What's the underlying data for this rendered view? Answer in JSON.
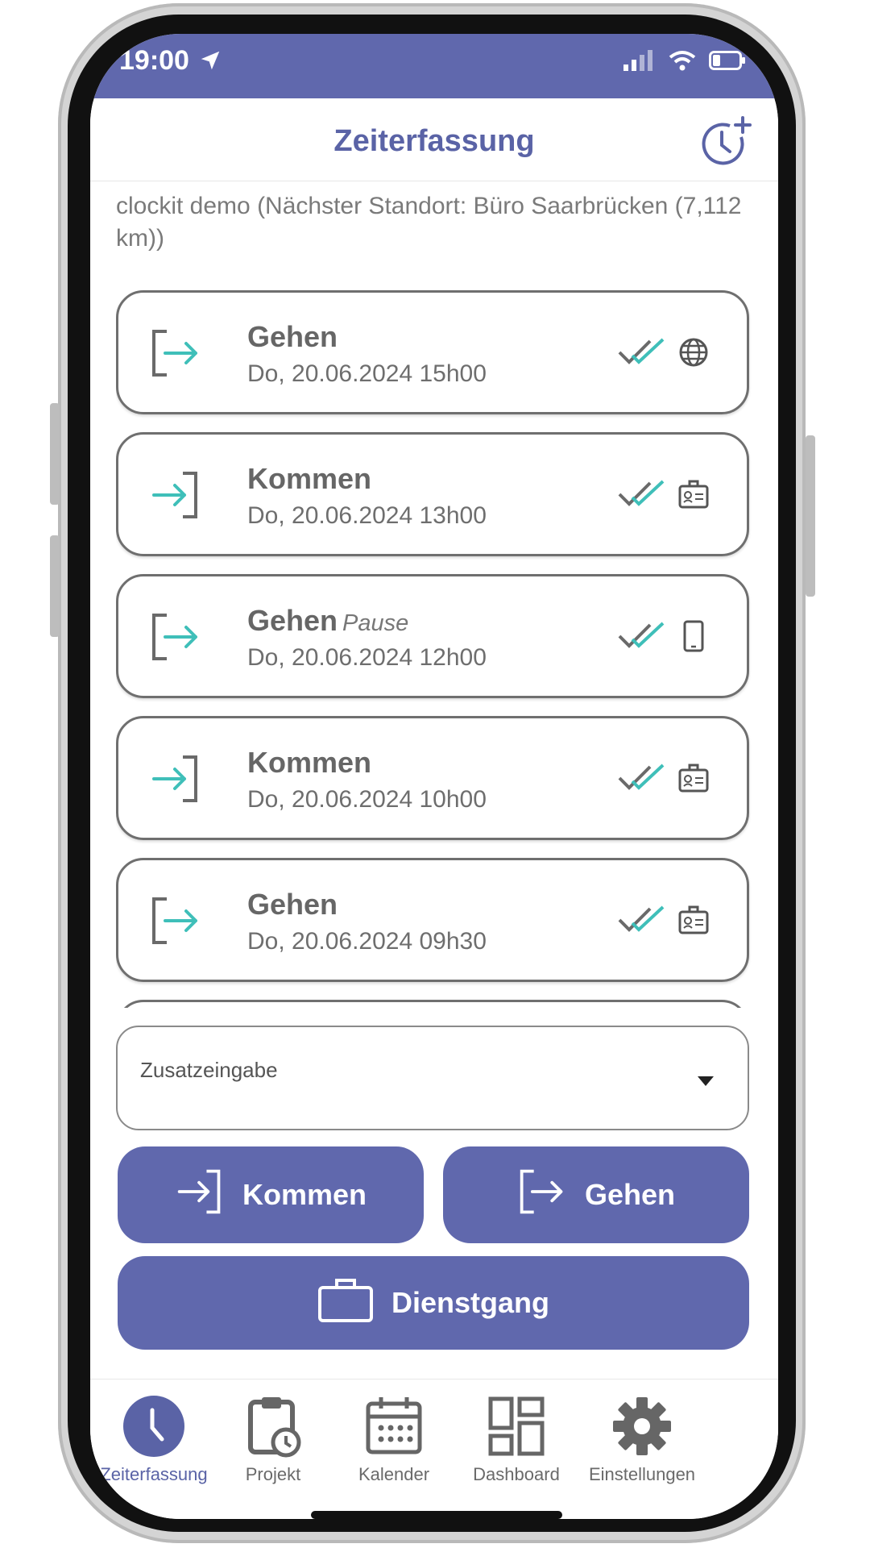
{
  "status_bar": {
    "time": "19:00"
  },
  "header": {
    "title": "Zeiterfassung"
  },
  "location_text": "clockit demo (Nächster Standort: Büro Saarbrücken (7,112 km))",
  "entries": [
    {
      "type": "Gehen",
      "note": "",
      "date": "Do, 20.06.2024 15h00",
      "direction": "out",
      "source_icon": "globe-icon"
    },
    {
      "type": "Kommen",
      "note": "",
      "date": "Do, 20.06.2024 13h00",
      "direction": "in",
      "source_icon": "id-badge-icon"
    },
    {
      "type": "Gehen",
      "note": "Pause",
      "date": "Do, 20.06.2024 12h00",
      "direction": "out",
      "source_icon": "smartphone-icon"
    },
    {
      "type": "Kommen",
      "note": "",
      "date": "Do, 20.06.2024 10h00",
      "direction": "in",
      "source_icon": "id-badge-icon"
    },
    {
      "type": "Gehen",
      "note": "",
      "date": "Do, 20.06.2024 09h30",
      "direction": "out",
      "source_icon": "id-badge-icon"
    }
  ],
  "dropdown": {
    "label": "Zusatzeingabe"
  },
  "buttons": {
    "kommen": "Kommen",
    "gehen": "Gehen",
    "dienstgang": "Dienstgang"
  },
  "tabs": [
    {
      "label": "Zeiterfassung",
      "icon": "clock-icon",
      "active": true
    },
    {
      "label": "Projekt",
      "icon": "clipboard-clock-icon",
      "active": false
    },
    {
      "label": "Kalender",
      "icon": "calendar-icon",
      "active": false
    },
    {
      "label": "Dashboard",
      "icon": "dashboard-icon",
      "active": false
    },
    {
      "label": "Einstellungen",
      "icon": "gear-icon",
      "active": false
    }
  ],
  "colors": {
    "primary": "#6068ad",
    "accent": "#3fbfb9",
    "text_gray": "#6e6e6e"
  }
}
